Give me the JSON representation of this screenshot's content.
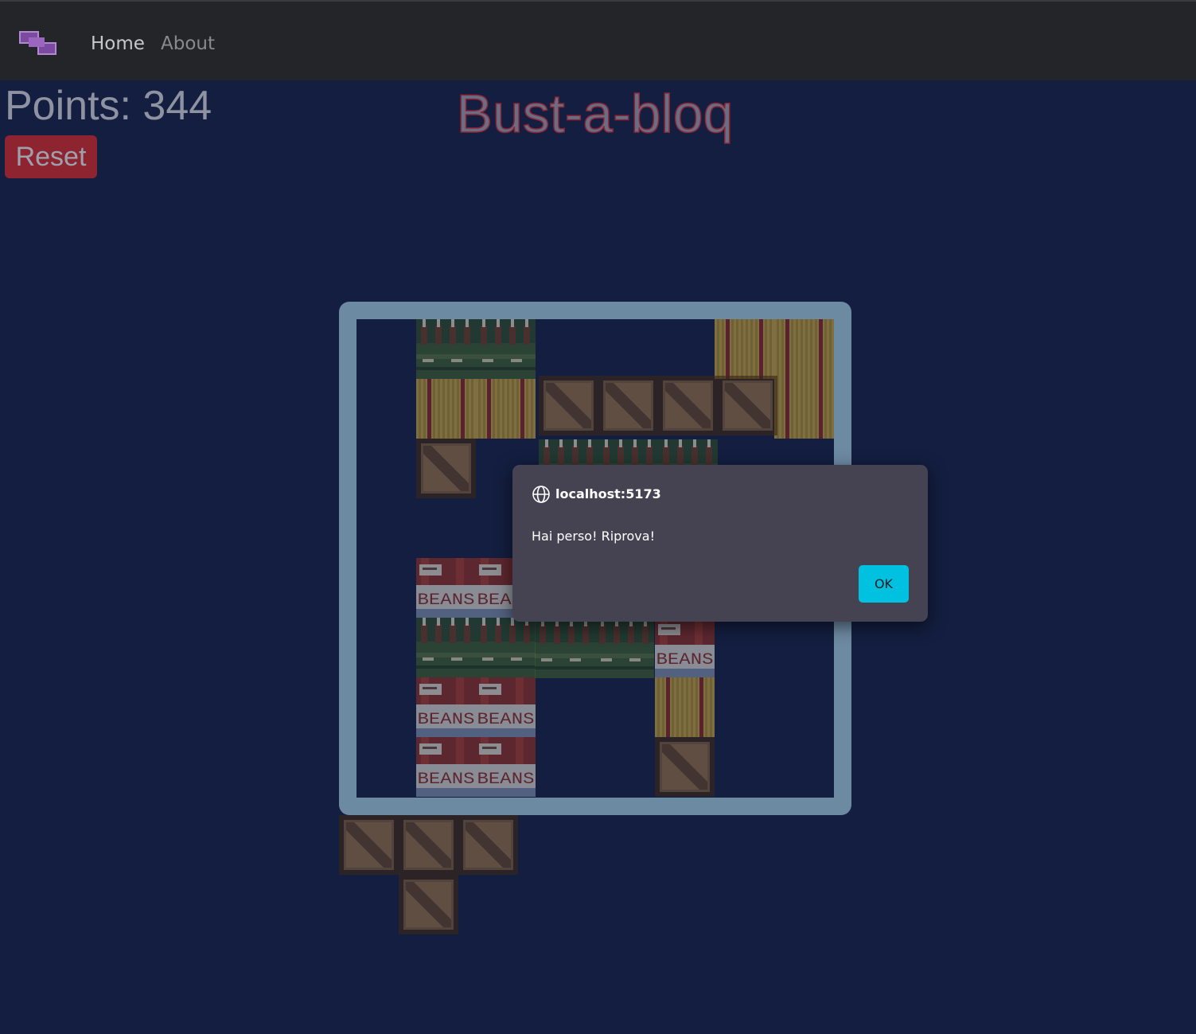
{
  "nav": {
    "logo_icon": "tetromino-logo-icon",
    "items": [
      {
        "label": "Home",
        "active": true
      },
      {
        "label": "About",
        "active": false
      }
    ]
  },
  "game": {
    "points_text": "Points: 344",
    "reset_label": "Reset",
    "title": "Bust-a-bloq",
    "board_size": 8,
    "tile_label": "BEANS",
    "tiles": [
      {
        "kind": "bottles",
        "row": 0,
        "col": 1
      },
      {
        "kind": "bottles",
        "row": 0,
        "col": 2
      },
      {
        "kind": "hay",
        "row": 0,
        "col": 6
      },
      {
        "kind": "hay",
        "row": 0,
        "col": 7
      },
      {
        "kind": "hay",
        "row": 1,
        "col": 1
      },
      {
        "kind": "hay",
        "row": 1,
        "col": 2
      },
      {
        "kind": "hay",
        "row": 1,
        "col": 7
      },
      {
        "kind": "crate",
        "row": 2,
        "col": 1
      },
      {
        "kind": "beans",
        "row": 4,
        "col": 1
      },
      {
        "kind": "beans",
        "row": 4,
        "col": 2
      },
      {
        "kind": "bottles",
        "row": 5,
        "col": 1
      },
      {
        "kind": "bottles",
        "row": 5,
        "col": 2
      },
      {
        "kind": "beans",
        "row": 5,
        "col": 5
      },
      {
        "kind": "beans",
        "row": 6,
        "col": 1
      },
      {
        "kind": "beans",
        "row": 6,
        "col": 2
      },
      {
        "kind": "hay",
        "row": 6,
        "col": 5
      },
      {
        "kind": "beans",
        "row": 7,
        "col": 1
      },
      {
        "kind": "beans",
        "row": 7,
        "col": 2
      },
      {
        "kind": "crate",
        "row": 7,
        "col": 5
      }
    ],
    "dragging_pieces": [
      {
        "kind": "crate",
        "cells": [
          [
            0,
            0
          ],
          [
            0,
            1
          ],
          [
            0,
            2
          ],
          [
            0,
            3
          ]
        ]
      },
      {
        "kind": "bottles",
        "cells": [
          [
            0,
            0
          ],
          [
            0,
            1
          ],
          [
            0,
            2
          ]
        ]
      },
      {
        "kind": "bottles",
        "cells": [
          [
            0,
            0
          ],
          [
            0,
            1
          ]
        ]
      }
    ],
    "tray_piece": {
      "kind": "crate",
      "cells": [
        [
          0,
          0
        ],
        [
          0,
          1
        ],
        [
          0,
          2
        ],
        [
          1,
          1
        ]
      ]
    }
  },
  "dialog": {
    "icon": "globe-icon",
    "origin": "localhost:5173",
    "message": "Hai perso! Riprova!",
    "ok_label": "OK"
  }
}
